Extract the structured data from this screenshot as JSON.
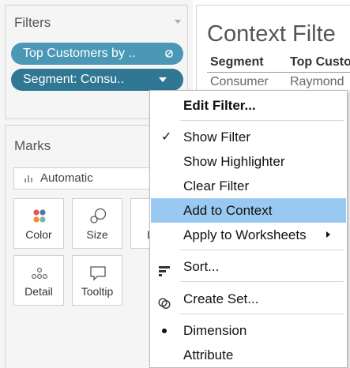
{
  "filters": {
    "title": "Filters",
    "pills": [
      {
        "label": "Top Customers by ..",
        "icon": "set-icon"
      },
      {
        "label": "Segment: Consu..",
        "icon": "chevron-down-icon"
      }
    ]
  },
  "marks": {
    "title": "Marks",
    "mark_type": "Automatic",
    "buttons": {
      "color": "Color",
      "size": "Size",
      "label": "L",
      "detail": "Detail",
      "tooltip": "Tooltip"
    }
  },
  "sheet": {
    "title": "Context Filte",
    "columns": [
      "Segment",
      "Top Custo"
    ],
    "rows": [
      [
        "Consumer",
        "Raymond"
      ]
    ]
  },
  "context_menu": {
    "items": {
      "edit_filter": "Edit Filter...",
      "show_filter": "Show Filter",
      "show_highlighter": "Show Highlighter",
      "clear_filter": "Clear Filter",
      "add_to_context": "Add to Context",
      "apply_to_worksheets": "Apply to Worksheets",
      "sort": "Sort...",
      "create_set": "Create Set...",
      "dimension": "Dimension",
      "attribute": "Attribute"
    },
    "checked": "show_filter",
    "highlighted": "add_to_context",
    "selected_role": "dimension"
  },
  "colors": {
    "pill_light": "#4a97b6",
    "pill_dark": "#2f7792",
    "menu_highlight": "#99c9f1"
  }
}
